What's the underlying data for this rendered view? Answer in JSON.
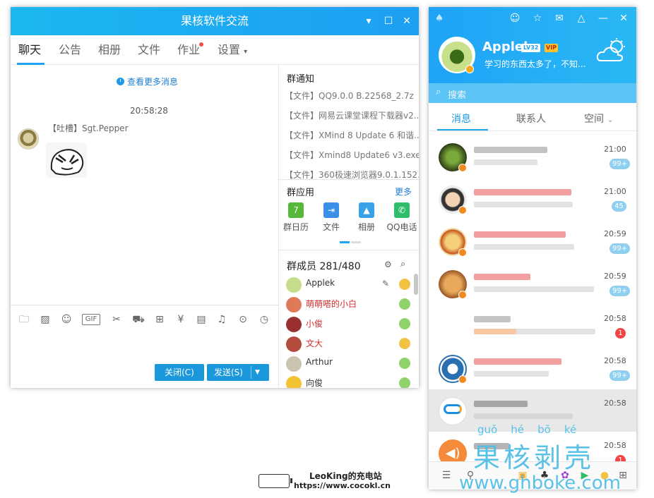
{
  "chat_window": {
    "title": "果核软件交流",
    "tabs": [
      "聊天",
      "公告",
      "相册",
      "文件",
      "作业",
      "设置"
    ],
    "settings_arrow": "▾",
    "view_more": "查看更多消息",
    "message_time": "20:58:28",
    "sender": "【吐槽】Sgt.Pepper",
    "close_button": "关闭(C)",
    "send_button": "发送(S)",
    "toolbar_gif": "GIF",
    "group_notice": {
      "title": "群通知",
      "items": [
        "【文件】QQ9.0.0 B.22568_2.7z",
        "【文件】网易云课堂课程下载器v2...",
        "【文件】XMind 8 Update 6 和谐...",
        "【文件】Xmind8 Update6 v3.exe",
        "【文件】360极速浏览器9.0.1.152..."
      ]
    },
    "group_apps": {
      "title": "群应用",
      "more": "更多",
      "apps": [
        "群日历",
        "文件",
        "相册",
        "QQ电话"
      ]
    },
    "members": {
      "title": "群成员 281/480",
      "list": [
        {
          "name": "Applek",
          "red": false
        },
        {
          "name": "萌萌嗒的小白",
          "red": true
        },
        {
          "name": "小俊",
          "red": true
        },
        {
          "name": "文大",
          "red": true
        },
        {
          "name": "Arthur",
          "red": false
        },
        {
          "name": "向俊",
          "red": false
        }
      ]
    }
  },
  "qq_panel": {
    "nickname": "Applek",
    "level_badge": "LV32",
    "vip_badge": "VIP",
    "signature": "学习的东西太多了，不知...",
    "search_placeholder": "搜索",
    "tabs": [
      "消息",
      "联系人",
      "空间"
    ],
    "space_arrow": "⌄",
    "conversations": [
      {
        "time": "21:00",
        "badge": "99+",
        "badge_red": false,
        "avatar_color": "#3e5a1e"
      },
      {
        "time": "21:00",
        "badge": "45",
        "badge_red": false,
        "avatar_color": "#444444"
      },
      {
        "time": "20:59",
        "badge": "99+",
        "badge_red": false,
        "avatar_color": "#d8a33a"
      },
      {
        "time": "20:59",
        "badge": "99+",
        "badge_red": false,
        "avatar_color": "#c07a3a"
      },
      {
        "time": "20:58",
        "badge": "1",
        "badge_red": true,
        "avatar_color": "#ffffff"
      },
      {
        "time": "20:58",
        "badge": "99+",
        "badge_red": false,
        "avatar_color": "#2a6fb0"
      },
      {
        "time": "20:58",
        "badge": "",
        "badge_red": false,
        "avatar_color": "#ffffff"
      },
      {
        "time": "20:58",
        "badge": "1",
        "badge_red": true,
        "avatar_color": "#f58a3a"
      }
    ]
  },
  "watermark": {
    "pinyin": "guǒ    hé    bō    ké",
    "chars": "果核剥壳",
    "url": "www.ghboke.com"
  },
  "caption": {
    "line1": "LeoKing的充电站",
    "line2": "https://www.cocokl.cn"
  },
  "colors": {
    "accent": "#1fa2f0",
    "button": "#1b97dc",
    "badge_blue": "#8fd0f0",
    "badge_red": "#f24545",
    "member_red": "#d42c2c"
  }
}
